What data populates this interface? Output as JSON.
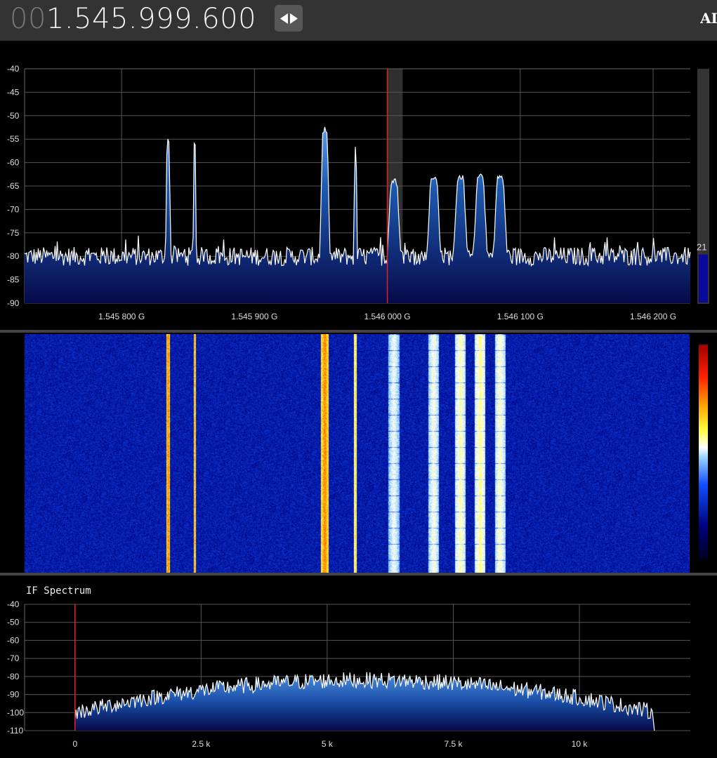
{
  "header": {
    "frequency_lead": "00",
    "frequency_main": "1.545.999.600",
    "right_label": "AI",
    "colors": {
      "bar": "#333333",
      "button": "#575757"
    }
  },
  "spectrum": {
    "chart_data": {
      "type": "area",
      "ylim": [
        -90,
        -40
      ],
      "yticks": [
        -40,
        -45,
        -50,
        -55,
        -60,
        -65,
        -70,
        -75,
        -80,
        -85,
        -90
      ],
      "ytick_labels": [
        "-40",
        "-45",
        "-50",
        "-55",
        "-60",
        "-65",
        "-70",
        "-75",
        "-80",
        "-85",
        "-90"
      ],
      "xlim_hz": [
        1545727000,
        1546228000
      ],
      "xticks_hz": [
        1545800000,
        1545900000,
        1546000000,
        1546100000,
        1546200000
      ],
      "xtick_labels": [
        "1.545 800 G",
        "1.545 900 G",
        "1.546 000 G",
        "1.546 100 G",
        "1.546 200 G"
      ],
      "noise_floor": -80,
      "peaks": [
        {
          "center_hz": 1545835000,
          "bw_hz": 3000,
          "level": -55
        },
        {
          "center_hz": 1545855000,
          "bw_hz": 2000,
          "level": -56
        },
        {
          "center_hz": 1545953000,
          "bw_hz": 6000,
          "level": -53
        },
        {
          "center_hz": 1545976000,
          "bw_hz": 2000,
          "level": -57
        },
        {
          "center_hz": 1546005000,
          "bw_hz": 8000,
          "level": -64
        },
        {
          "center_hz": 1546035000,
          "bw_hz": 8000,
          "level": -63
        },
        {
          "center_hz": 1546055000,
          "bw_hz": 8000,
          "level": -63
        },
        {
          "center_hz": 1546070000,
          "bw_hz": 8000,
          "level": -63
        },
        {
          "center_hz": 1546085000,
          "bw_hz": 8000,
          "level": -63
        }
      ],
      "tuned_hz": 1546000000,
      "filter_hz": [
        1546000000,
        1546011500
      ]
    },
    "gain_value": "21",
    "gain_level": 0.21
  },
  "waterfall": {
    "colormap": [
      "#000020",
      "#00007a",
      "#1050ff",
      "#a0d8ff",
      "#ffffff",
      "#ffff40",
      "#ffa000",
      "#ff2000",
      "#a00000"
    ]
  },
  "if_spectrum": {
    "title": "IF Spectrum",
    "chart_data": {
      "type": "area",
      "ylim": [
        -110,
        -40
      ],
      "yticks": [
        -40,
        -50,
        -60,
        -70,
        -80,
        -90,
        -100,
        -110
      ],
      "ytick_labels": [
        "-40",
        "-50",
        "-60",
        "-70",
        "-80",
        "-90",
        "-100",
        "-110"
      ],
      "xlim_hz": [
        -1000,
        12200
      ],
      "xticks_hz": [
        0,
        2500,
        5000,
        7500,
        10000
      ],
      "xtick_labels": [
        "0",
        "2.5 k",
        "5 k",
        "7.5 k",
        "10 k"
      ],
      "marker_hz": 0,
      "band_hz": [
        0,
        11500
      ],
      "edge_level": -100,
      "center_level": -82
    }
  }
}
